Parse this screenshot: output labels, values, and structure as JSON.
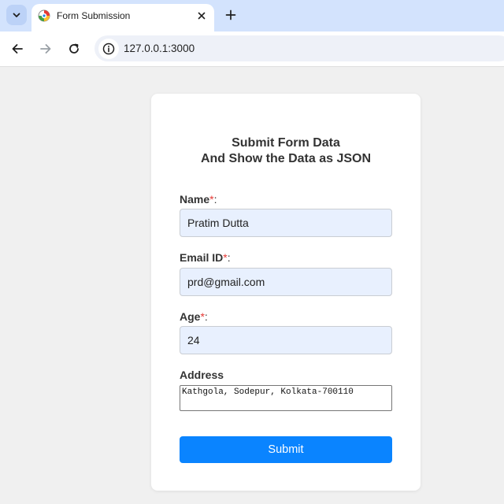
{
  "browser": {
    "tab_title": "Form Submission",
    "url": "127.0.0.1:3000"
  },
  "form": {
    "heading_line1": "Submit Form Data",
    "heading_line2": "And Show the Data as JSON",
    "name_label": "Name",
    "name_value": "Pratim Dutta",
    "email_label": "Email ID",
    "email_value": "prd@gmail.com",
    "age_label": "Age",
    "age_value": "24",
    "address_label": "Address",
    "address_value": "Kathgola, Sodepur, Kolkata-700110",
    "required_mark": "*",
    "colon": ":",
    "submit_label": "Submit"
  },
  "colors": {
    "accent": "#0a84ff",
    "required": "#e53935",
    "autofill_bg": "#e8f0fe",
    "tabstrip": "#d3e3fd"
  },
  "icons": [
    "tab-search-icon",
    "favicon-icon",
    "close-icon",
    "plus-icon",
    "back-arrow-icon",
    "forward-arrow-icon",
    "reload-icon",
    "info-icon"
  ]
}
